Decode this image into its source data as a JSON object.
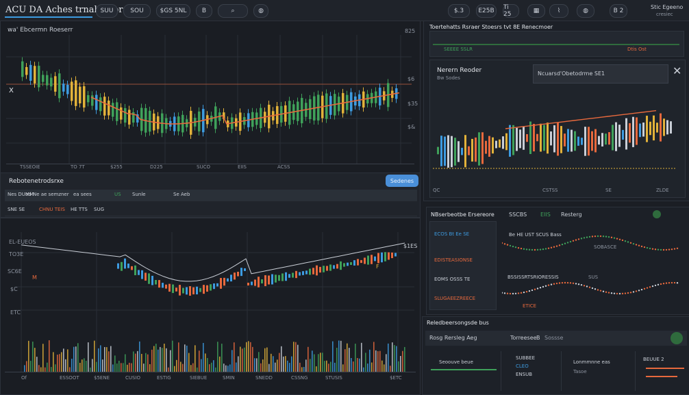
{
  "app": {
    "title": "ACU DA Aches trnahestor"
  },
  "toolbar": {
    "left_items": [
      "SUU",
      "SOU",
      "$GS 5NL",
      "B"
    ],
    "right_items": [
      "$.3",
      "E25B",
      "Ti 25",
      "B 2",
      "Stic Egeeno"
    ],
    "right_sub": "cresiec"
  },
  "main_chart": {
    "header": "wa' Ebcermn Roeserr",
    "price_top": "825",
    "y_labels": [
      "825",
      "$6",
      "$35",
      "$&"
    ],
    "x_labels": [
      "TSSEOIE",
      "TO 7T",
      "$255",
      "D225",
      "SUCO",
      "EIIS",
      "ACSS"
    ],
    "left_marks": [
      "X"
    ],
    "colors": {
      "up": "#3fa15a",
      "down": "#3d9be0",
      "accent": "#e7693d",
      "warn": "#e2b23a"
    }
  },
  "orders": {
    "title": "Rebotenetrodsrxe",
    "button_label": "Sedenes",
    "header_cols": [
      "Nes DUMM",
      "od Ne ae semzner",
      "ea sees",
      "US",
      "Sunle",
      "Se Aeb"
    ],
    "row_cols": [
      "SNE SE",
      "CHNU TEIS",
      "HE TTS",
      "SUG"
    ]
  },
  "lower_chart": {
    "y_labels": [
      "EL-EUEOS",
      "TO3E",
      "SC6E",
      "$C",
      "ETC"
    ],
    "x_labels": [
      "Of",
      "ESSOOT",
      "$5ENE",
      "CUSIO",
      "ESTIG",
      "SIEBUE",
      "SMIN",
      "SNEDD",
      "CSSNG",
      "STUSIS",
      "$ETC"
    ],
    "right_label": "$1ES",
    "marks": [
      "M",
      "F"
    ]
  },
  "right_panel": {
    "header": "Toertehatts Rsraer Stoesrs tvt 8E Renecmoer",
    "subheader_items": [
      "SEEEE SSLR",
      "Dtis Ost"
    ],
    "box_title": "Nerern Reoder",
    "box_sub": "Bw Sodes",
    "info_label": "Ncuarsd'Obetodrme SE1",
    "x_labels": [
      "QC",
      "CSTSS",
      "SE",
      "ZLDE"
    ]
  },
  "watchlist": {
    "title": "NBserbeotbe Ersereore",
    "tabs": [
      "SSCBS",
      "EIIS",
      "Resterg"
    ],
    "rows": [
      "ECOS Bt Ee SE",
      "EDISTEASIONSE",
      "EOMS OSSS TE",
      "SLUGAEEZREECE"
    ],
    "chart_labels": [
      "Be HE UST SCUS Bass",
      "SOBASCE",
      "BSSISSRTSRIORESSIS",
      "SUS",
      "ETICE"
    ]
  },
  "bottom_right": {
    "title": "Reledbeersongsde bus",
    "header": "Rosg Rersleg Aeg",
    "header_right": [
      "Torreesee",
      "B",
      "Sossse"
    ],
    "items": [
      "Seoouve beue",
      "SUBBEE",
      "CLEO",
      "ENSUB",
      "Lonmmnne eas",
      "Tasoe",
      "BEUUE 2"
    ]
  }
}
